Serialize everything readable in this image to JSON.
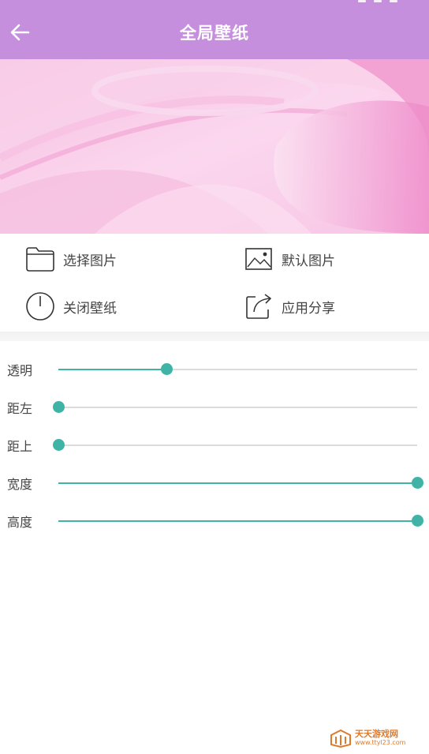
{
  "header": {
    "title": "全局壁纸",
    "back_icon": "arrow-left-icon",
    "background": "#c58fde"
  },
  "preview": {
    "description_color_primary": "#f7c6e3"
  },
  "actions": [
    {
      "label": "选择图片",
      "icon": "folder-icon"
    },
    {
      "label": "默认图片",
      "icon": "image-icon"
    },
    {
      "label": "关闭壁纸",
      "icon": "power-icon"
    },
    {
      "label": "应用分享",
      "icon": "share-icon"
    }
  ],
  "sliders": [
    {
      "label": "透明",
      "value_fraction": 0.3
    },
    {
      "label": "距左",
      "value_fraction": 0.0
    },
    {
      "label": "距上",
      "value_fraction": 0.0
    },
    {
      "label": "宽度",
      "value_fraction": 1.0
    },
    {
      "label": "高度",
      "value_fraction": 1.0
    }
  ],
  "accent_color": "#3fb3a6",
  "watermark": {
    "name": "天天游戏网",
    "url": "www.ttyl23.com"
  }
}
